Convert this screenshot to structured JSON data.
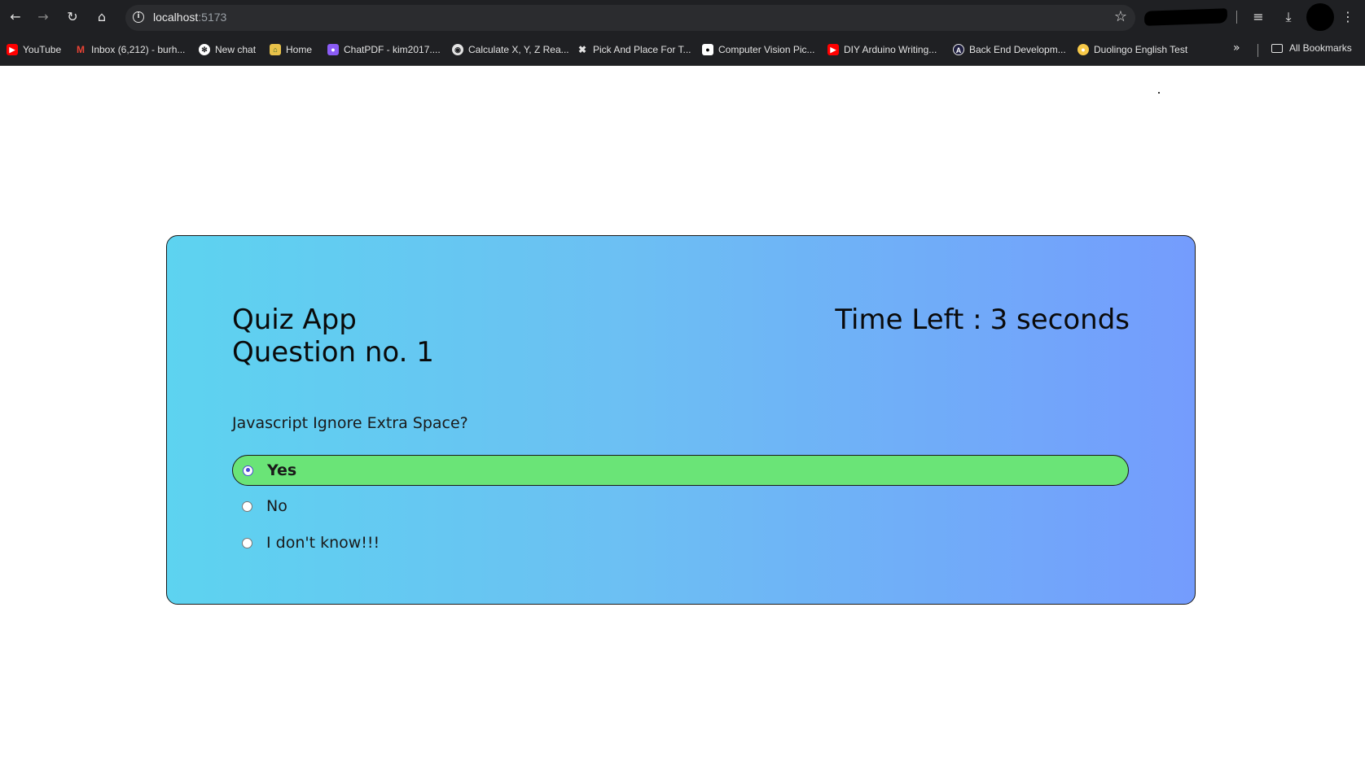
{
  "browser": {
    "url_host": "localhost",
    "url_port": ":5173",
    "bookmarks": [
      {
        "label": "YouTube",
        "icon": "youtube-icon",
        "color": "#ff0000"
      },
      {
        "label": "Inbox (6,212) - burh...",
        "icon": "gmail-icon",
        "color": "#ea4335"
      },
      {
        "label": "New chat",
        "icon": "chatgpt-icon",
        "color": "#ffffff"
      },
      {
        "label": "Home",
        "icon": "home-bookmark-icon",
        "color": "#e8c24a"
      },
      {
        "label": "ChatPDF - kim2017....",
        "icon": "chatpdf-icon",
        "color": "#8b5cf6"
      },
      {
        "label": "Calculate X, Y, Z Rea...",
        "icon": "globe-icon",
        "color": "#e3e3e3"
      },
      {
        "label": "Pick And Place For T...",
        "icon": "robot-icon",
        "color": "#e3e3e3"
      },
      {
        "label": "Computer Vision Pic...",
        "icon": "medium-icon",
        "color": "#ffffff"
      },
      {
        "label": "DIY Arduino Writing...",
        "icon": "youtube-icon",
        "color": "#ff0000"
      },
      {
        "label": "Back End Developm...",
        "icon": "angular-icon",
        "color": "#1e1e3f"
      },
      {
        "label": "Duolingo English Test",
        "icon": "duolingo-icon",
        "color": "#f7c948"
      }
    ],
    "all_bookmarks_label": "All Bookmarks"
  },
  "quiz": {
    "title": "Quiz App",
    "question_number_label": "Question no. 1",
    "timer_prefix": "Time Left :",
    "timer_value": "3 seconds",
    "question": "Javascript Ignore Extra Space?",
    "options": [
      {
        "label": "Yes",
        "selected": true
      },
      {
        "label": "No",
        "selected": false
      },
      {
        "label": "I don't know!!!",
        "selected": false
      }
    ],
    "selected_color": "#6ae477"
  }
}
